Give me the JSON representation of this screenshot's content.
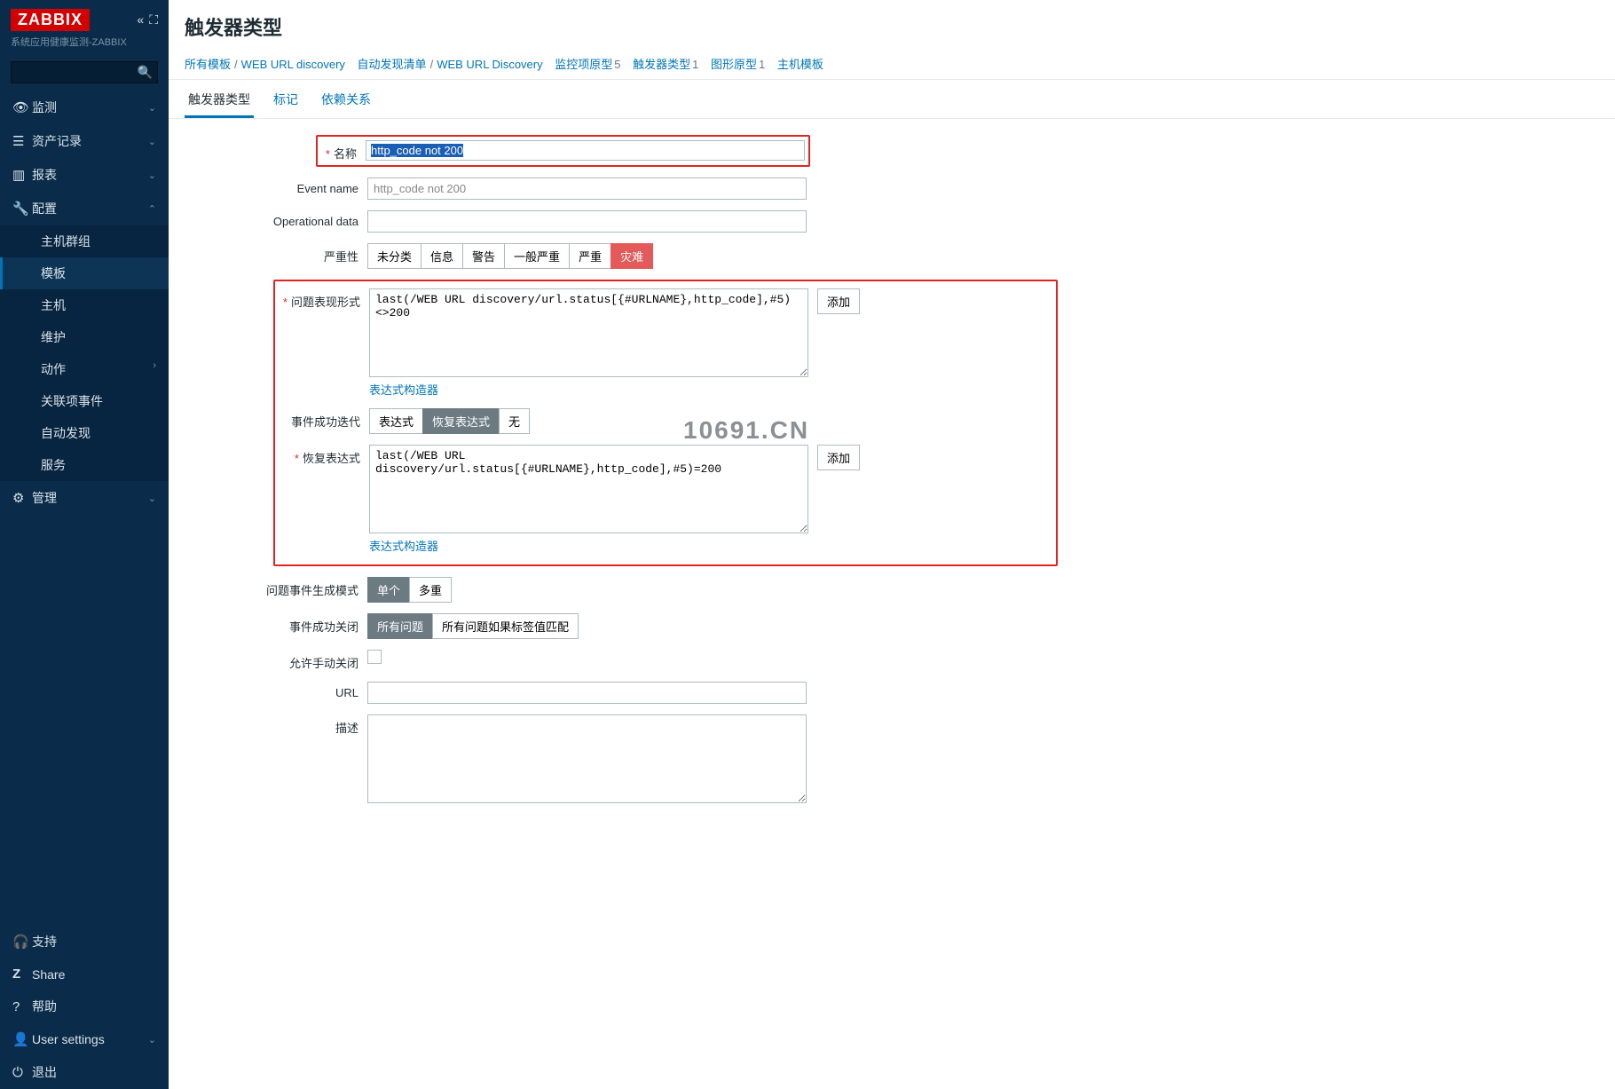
{
  "app": {
    "logo_text": "ZABBIX",
    "subtitle": "系统应用健康监测-ZABBIX",
    "search_placeholder": ""
  },
  "sidebar": {
    "items": [
      {
        "icon": "◉",
        "label": "监测",
        "chev": "⌄"
      },
      {
        "icon": "≡",
        "label": "资产记录",
        "chev": "⌄"
      },
      {
        "icon": "▭",
        "label": "报表",
        "chev": "⌄"
      },
      {
        "icon": "🔧",
        "label": "配置",
        "chev": "⌃"
      },
      {
        "icon": "⚙",
        "label": "管理",
        "chev": "⌄"
      }
    ],
    "config_sub": [
      "主机群组",
      "模板",
      "主机",
      "维护",
      "动作",
      "关联项事件",
      "自动发现",
      "服务"
    ],
    "bottom": [
      {
        "icon": "🎧",
        "label": "支持"
      },
      {
        "icon": "z",
        "label": "Share"
      },
      {
        "icon": "?",
        "label": "帮助"
      },
      {
        "icon": "👤",
        "label": "User settings",
        "chev": "⌄"
      },
      {
        "icon": "⏻",
        "label": "退出"
      }
    ]
  },
  "page": {
    "title": "触发器类型"
  },
  "breadcrumb": {
    "all_templates": "所有模板",
    "tpl": "WEB URL discovery",
    "discovery_list": "自动发现清单",
    "rule": "WEB URL Discovery",
    "items": {
      "label": "监控项原型",
      "count": "5"
    },
    "triggers": {
      "label": "触发器类型",
      "count": "1"
    },
    "graphs": {
      "label": "图形原型",
      "count": "1"
    },
    "hosts": "主机模板"
  },
  "tabs": [
    "触发器类型",
    "标记",
    "依赖关系"
  ],
  "form": {
    "name_label": "名称",
    "name_value": "http_code not 200",
    "event_name_label": "Event name",
    "event_name_value": "http_code not 200",
    "opdata_label": "Operational data",
    "opdata_value": "",
    "severity_label": "严重性",
    "severity_opts": [
      "未分类",
      "信息",
      "警告",
      "一般严重",
      "严重",
      "灾难"
    ],
    "problem_expr_label": "问题表现形式",
    "problem_expr_value": "last(/WEB URL discovery/url.status[{#URLNAME},http_code],#5)<>200",
    "add_btn": "添加",
    "expr_builder": "表达式构造器",
    "ok_iter_label": "事件成功迭代",
    "ok_iter_opts": [
      "表达式",
      "恢复表达式",
      "无"
    ],
    "recovery_expr_label": "恢复表达式",
    "recovery_expr_value": "last(/WEB URL discovery/url.status[{#URLNAME},http_code],#5)=200",
    "gen_mode_label": "问题事件生成模式",
    "gen_mode_opts": [
      "单个",
      "多重"
    ],
    "ok_close_label": "事件成功关闭",
    "ok_close_opts": [
      "所有问题",
      "所有问题如果标签值匹配"
    ],
    "manual_close_label": "允许手动关闭",
    "url_label": "URL",
    "url_value": "",
    "desc_label": "描述",
    "desc_value": ""
  },
  "watermark": "10691.CN"
}
